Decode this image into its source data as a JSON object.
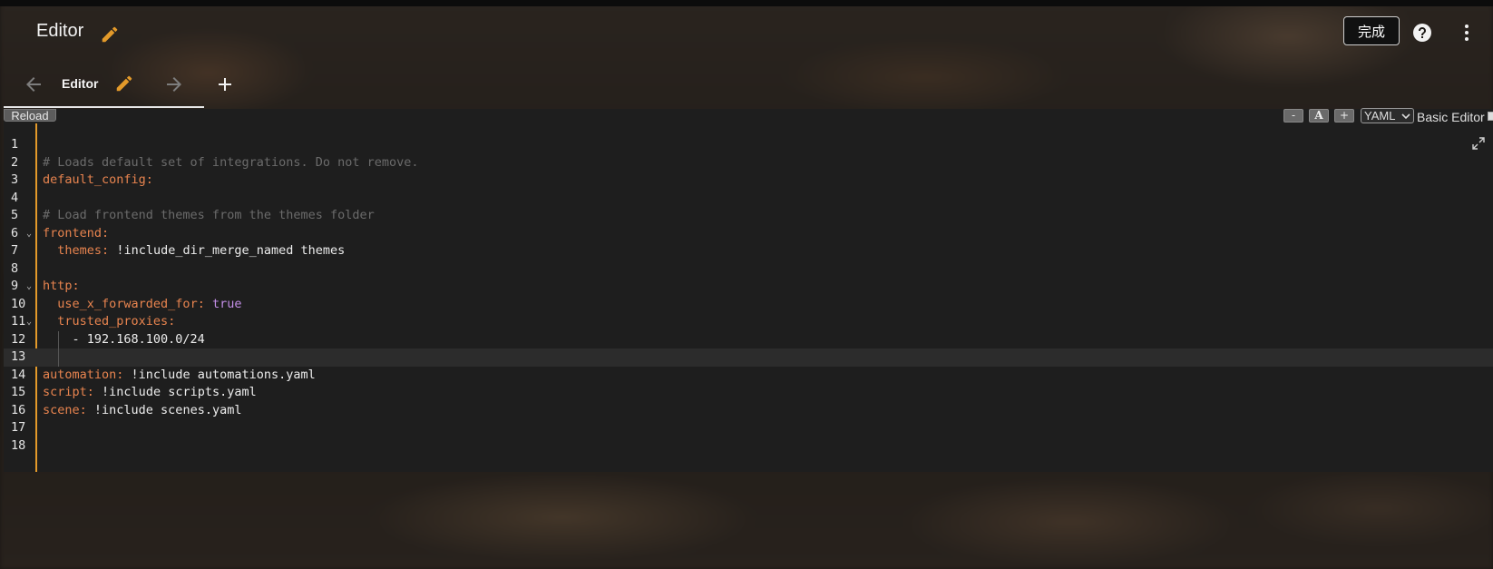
{
  "app_bar": {
    "title": "Editor",
    "done_label": "完成"
  },
  "tab": {
    "label": "Editor"
  },
  "toolbar": {
    "reload_label": "Reload",
    "font_decrease": "-",
    "font_reset": "A",
    "font_increase": "+",
    "language": "YAML",
    "basic_editor_label": "Basic Editor"
  },
  "colors": {
    "accent": "#e39a2a",
    "key": "#e8844f",
    "comment": "#6b6b6b",
    "boolean": "#c48fe8"
  },
  "code": {
    "active_line": 13,
    "lines": [
      {
        "n": "1",
        "parts": []
      },
      {
        "n": "2",
        "parts": [
          {
            "t": "comment",
            "v": "# Loads default set of integrations. Do not remove."
          }
        ]
      },
      {
        "n": "3",
        "parts": [
          {
            "t": "key",
            "v": "default_config"
          },
          {
            "t": "punc",
            "v": ":"
          }
        ]
      },
      {
        "n": "4",
        "parts": []
      },
      {
        "n": "5",
        "parts": [
          {
            "t": "comment",
            "v": "# Load frontend themes from the themes folder"
          }
        ]
      },
      {
        "n": "6",
        "fold": true,
        "parts": [
          {
            "t": "key",
            "v": "frontend"
          },
          {
            "t": "punc",
            "v": ":"
          }
        ]
      },
      {
        "n": "7",
        "parts": [
          {
            "t": "plain",
            "v": "  "
          },
          {
            "t": "key",
            "v": "themes"
          },
          {
            "t": "punc",
            "v": ": "
          },
          {
            "t": "plain",
            "v": "!include_dir_merge_named themes"
          }
        ]
      },
      {
        "n": "8",
        "parts": []
      },
      {
        "n": "9",
        "fold": true,
        "parts": [
          {
            "t": "key",
            "v": "http"
          },
          {
            "t": "punc",
            "v": ":"
          }
        ]
      },
      {
        "n": "10",
        "parts": [
          {
            "t": "plain",
            "v": "  "
          },
          {
            "t": "key",
            "v": "use_x_forwarded_for"
          },
          {
            "t": "punc",
            "v": ": "
          },
          {
            "t": "bool",
            "v": "true"
          }
        ]
      },
      {
        "n": "11",
        "fold": true,
        "parts": [
          {
            "t": "plain",
            "v": "  "
          },
          {
            "t": "key",
            "v": "trusted_proxies"
          },
          {
            "t": "punc",
            "v": ":"
          }
        ]
      },
      {
        "n": "12",
        "guide": true,
        "parts": [
          {
            "t": "plain",
            "v": "    - 192.168.100.0/24"
          }
        ]
      },
      {
        "n": "13",
        "guide": true,
        "parts": []
      },
      {
        "n": "14",
        "parts": [
          {
            "t": "key",
            "v": "automation"
          },
          {
            "t": "punc",
            "v": ": "
          },
          {
            "t": "plain",
            "v": "!include automations.yaml"
          }
        ]
      },
      {
        "n": "15",
        "parts": [
          {
            "t": "key",
            "v": "script"
          },
          {
            "t": "punc",
            "v": ": "
          },
          {
            "t": "plain",
            "v": "!include scripts.yaml"
          }
        ]
      },
      {
        "n": "16",
        "parts": [
          {
            "t": "key",
            "v": "scene"
          },
          {
            "t": "punc",
            "v": ": "
          },
          {
            "t": "plain",
            "v": "!include scenes.yaml"
          }
        ]
      },
      {
        "n": "17",
        "parts": []
      },
      {
        "n": "18",
        "parts": []
      }
    ]
  }
}
